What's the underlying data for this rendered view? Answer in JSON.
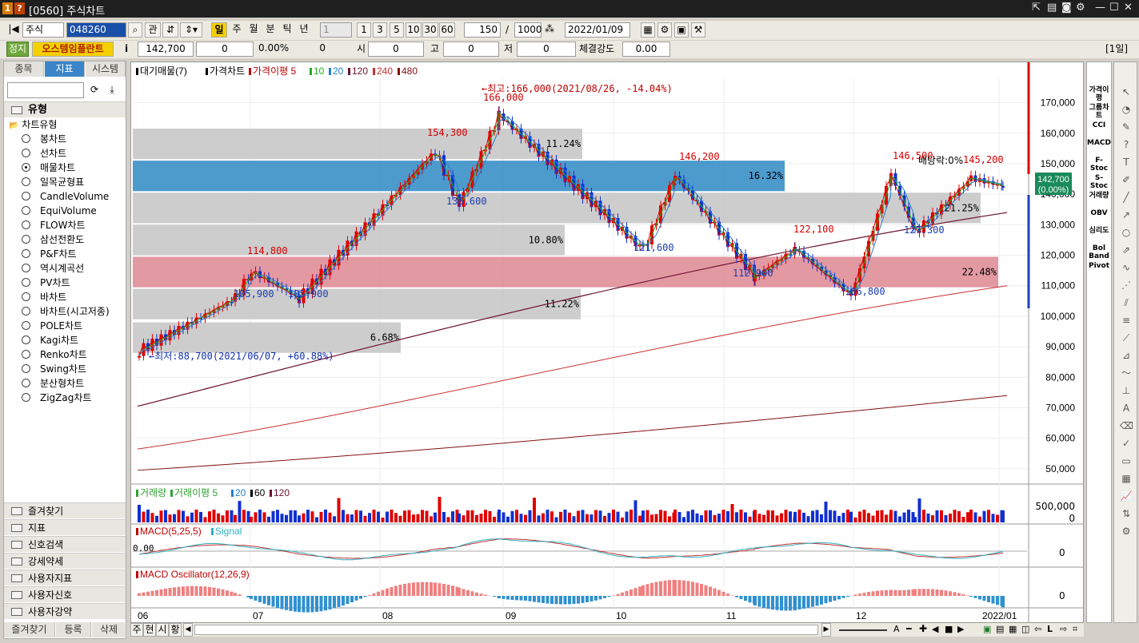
{
  "window": {
    "badge1": "1",
    "badge2": "?",
    "title": "[0560] 주식차트"
  },
  "toolbar": {
    "market": "주식",
    "code": "048260",
    "btn_gwan": "관",
    "periods": [
      "일",
      "주",
      "월",
      "분",
      "틱",
      "년"
    ],
    "multiplier": "1",
    "minute_presets": [
      "1",
      "3",
      "5",
      "10",
      "30",
      "60"
    ],
    "count": "150",
    "slash": "/",
    "total": "1000",
    "date": "2022/01/09"
  },
  "infobar": {
    "status": "정지",
    "name": "오스템임플란트",
    "info_btn": "i",
    "price": "142,700",
    "change": "0",
    "change_pct": "0.00%",
    "volume": "0",
    "open_label": "시",
    "open": "0",
    "high_label": "고",
    "high": "0",
    "low_label": "저",
    "low": "0",
    "strength_label": "체결강도",
    "strength": "0.00",
    "period_tag": "[1일]"
  },
  "left": {
    "tabs": [
      "종목",
      "지표",
      "시스템"
    ],
    "group_title": "유형",
    "tree_title": "차트유형",
    "items": [
      {
        "label": "봉차트",
        "on": false
      },
      {
        "label": "선차트",
        "on": false
      },
      {
        "label": "매물차트",
        "on": true
      },
      {
        "label": "일목균형표",
        "on": false
      },
      {
        "label": "CandleVolume",
        "on": false
      },
      {
        "label": "EquiVolume",
        "on": false
      },
      {
        "label": "FLOW차트",
        "on": false
      },
      {
        "label": "삼선전환도",
        "on": false
      },
      {
        "label": "P&F차트",
        "on": false
      },
      {
        "label": "역시계곡선",
        "on": false
      },
      {
        "label": "PV차트",
        "on": false
      },
      {
        "label": "바차트",
        "on": false
      },
      {
        "label": "바차트(시고저종)",
        "on": false
      },
      {
        "label": "POLE차트",
        "on": false
      },
      {
        "label": "Kagi차트",
        "on": false
      },
      {
        "label": "Renko차트",
        "on": false
      },
      {
        "label": "Swing차트",
        "on": false
      },
      {
        "label": "분산형차트",
        "on": false
      },
      {
        "label": "ZigZag차트",
        "on": false
      }
    ],
    "sections": [
      "즐겨찾기",
      "지표",
      "신호검색",
      "강세약세",
      "사용자지표",
      "사용자신호",
      "사용자강약"
    ],
    "bottom_tabs": [
      "즐겨찾기",
      "등록",
      "삭제"
    ]
  },
  "price_pane": {
    "legend": [
      "대기매물(7)",
      "가격차트",
      "가격이평 5",
      "10",
      "20",
      "120",
      "240",
      "480"
    ],
    "high_note": "←최고:166,000(2021/08/26, -14.04%)",
    "low_note": "←최저:88,700(2021/06/07, +60.88%)",
    "dividend_note": "배당락:0%",
    "current_price": "142,700",
    "current_pct": "(0.00%)",
    "price_labels": [
      {
        "t": "166,000",
        "c": "#d40000"
      },
      {
        "t": "154,300",
        "c": "#d40000"
      },
      {
        "t": "136,600",
        "c": "#1a3fb0"
      },
      {
        "t": "114,800",
        "c": "#d40000"
      },
      {
        "t": "105,900",
        "c": "#1a3fb0"
      },
      {
        "t": "105,900",
        "c": "#1a3fb0"
      },
      {
        "t": "146,200",
        "c": "#d40000"
      },
      {
        "t": "121,600",
        "c": "#1a3fb0"
      },
      {
        "t": "122,100",
        "c": "#d40000"
      },
      {
        "t": "112,900",
        "c": "#1a3fb0"
      },
      {
        "t": "106,800",
        "c": "#1a3fb0"
      },
      {
        "t": "146,500",
        "c": "#d40000"
      },
      {
        "t": "145,200",
        "c": "#d40000"
      },
      {
        "t": "127,300",
        "c": "#1a3fb0"
      }
    ],
    "yticks": [
      "170,000",
      "160,000",
      "150,000",
      "140,000",
      "130,000",
      "120,000",
      "110,000",
      "100,000",
      "90,000",
      "80,000",
      "70,000",
      "60,000",
      "50,000"
    ],
    "volume_profile": [
      {
        "pct": "6.68%",
        "lo": 88000,
        "hi": 98000,
        "color": "#c8c8c8"
      },
      {
        "pct": "11.22%",
        "lo": 99000,
        "hi": 109000,
        "color": "#c8c8c8"
      },
      {
        "pct": "22.48%",
        "lo": 109500,
        "hi": 119500,
        "color": "#e08e98"
      },
      {
        "pct": "10.80%",
        "lo": 120000,
        "hi": 130000,
        "color": "#c8c8c8"
      },
      {
        "pct": "21.25%",
        "lo": 130500,
        "hi": 140500,
        "color": "#c8c8c8"
      },
      {
        "pct": "16.32%",
        "lo": 141000,
        "hi": 151000,
        "color": "#3a8fc8"
      },
      {
        "pct": "11.24%",
        "lo": 151500,
        "hi": 161500,
        "color": "#c8c8c8"
      }
    ]
  },
  "volume_pane": {
    "legend": [
      "거래량",
      "거래이평 5",
      "20",
      "60",
      "120"
    ],
    "ticks": [
      "500,000",
      "0"
    ]
  },
  "macd_pane": {
    "legend": [
      "MACD(5,25,5)",
      "Signal"
    ],
    "zero_label": "0.00",
    "tick": "0"
  },
  "osc_pane": {
    "legend": [
      "MACD Oscillator(12,26,9)"
    ],
    "tick": "0"
  },
  "xaxis": [
    "06",
    "07",
    "08",
    "09",
    "10",
    "11",
    "12",
    "2022/01"
  ],
  "bottom": {
    "buttons": [
      "주",
      "현",
      "시",
      "황"
    ]
  },
  "right_tools": [
    "가격이평",
    "그룹차트",
    "CCI",
    "MACD",
    "F-Stoc",
    "S-Stoc",
    "거래량",
    "OBV",
    "심리도",
    "Bol Band",
    "Pivot"
  ],
  "chart_data": {
    "type": "candlestick",
    "period_start": "2021/06",
    "period_end": "2022/01",
    "high": 166000,
    "high_date": "2021/08/26",
    "low": 88700,
    "low_date": "2021/06/07",
    "last": 142700,
    "ylim": [
      45000,
      178000
    ],
    "swing_points": [
      {
        "x": "06",
        "y": 88700
      },
      {
        "x": "06",
        "y": 105900
      },
      {
        "x": "07",
        "y": 114800
      },
      {
        "x": "07",
        "y": 105900
      },
      {
        "x": "08",
        "y": 154300
      },
      {
        "x": "08",
        "y": 136600
      },
      {
        "x": "08",
        "y": 166000
      },
      {
        "x": "10",
        "y": 121600
      },
      {
        "x": "10",
        "y": 146200
      },
      {
        "x": "11",
        "y": 112900
      },
      {
        "x": "11",
        "y": 122100
      },
      {
        "x": "12",
        "y": 106800
      },
      {
        "x": "12",
        "y": 146500
      },
      {
        "x": "12",
        "y": 127300
      },
      {
        "x": "2022/01",
        "y": 145200
      },
      {
        "x": "2022/01",
        "y": 142700
      }
    ]
  }
}
